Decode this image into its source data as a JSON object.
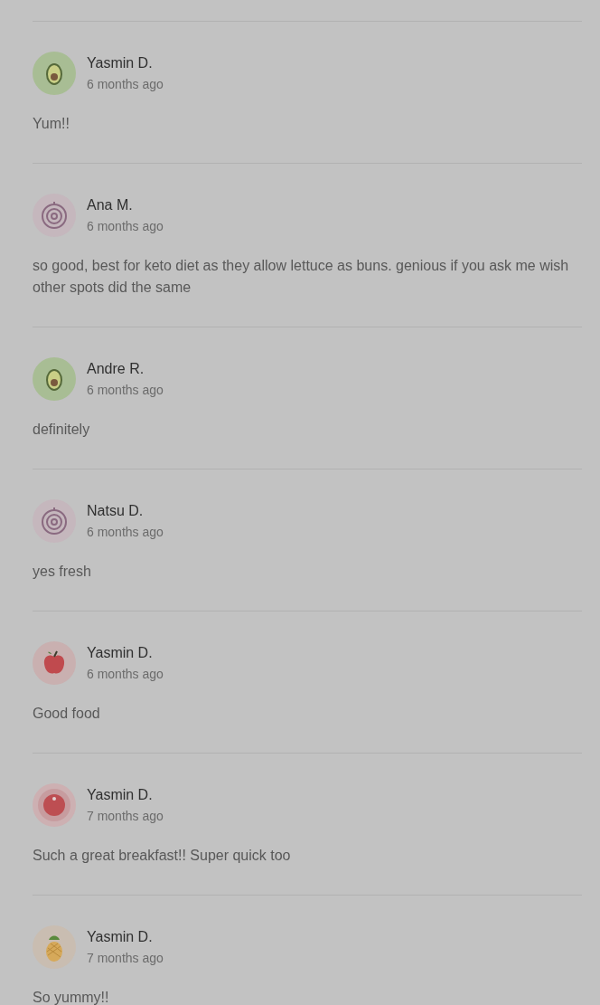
{
  "comments": [
    {
      "avatar": {
        "kind": "avocado"
      },
      "name": "Yasmin D.",
      "time": "6 months ago",
      "text": "Yum!!"
    },
    {
      "avatar": {
        "kind": "onion"
      },
      "name": "Ana M.",
      "time": "6 months ago",
      "text": "so good, best for keto diet as they allow lettuce as buns. genious if you ask me wish other spots did the same"
    },
    {
      "avatar": {
        "kind": "avocado"
      },
      "name": "Andre R.",
      "time": "6 months ago",
      "text": "definitely"
    },
    {
      "avatar": {
        "kind": "onion"
      },
      "name": "Natsu D.",
      "time": "6 months ago",
      "text": "yes fresh"
    },
    {
      "avatar": {
        "kind": "apple"
      },
      "name": "Yasmin D.",
      "time": "6 months ago",
      "text": "Good food"
    },
    {
      "avatar": {
        "kind": "tomato"
      },
      "name": "Yasmin D.",
      "time": "7 months ago",
      "text": "Such a great breakfast!! Super quick too"
    },
    {
      "avatar": {
        "kind": "pineapple"
      },
      "name": "Yasmin D.",
      "time": "7 months ago",
      "text": "So yummy!!"
    }
  ]
}
